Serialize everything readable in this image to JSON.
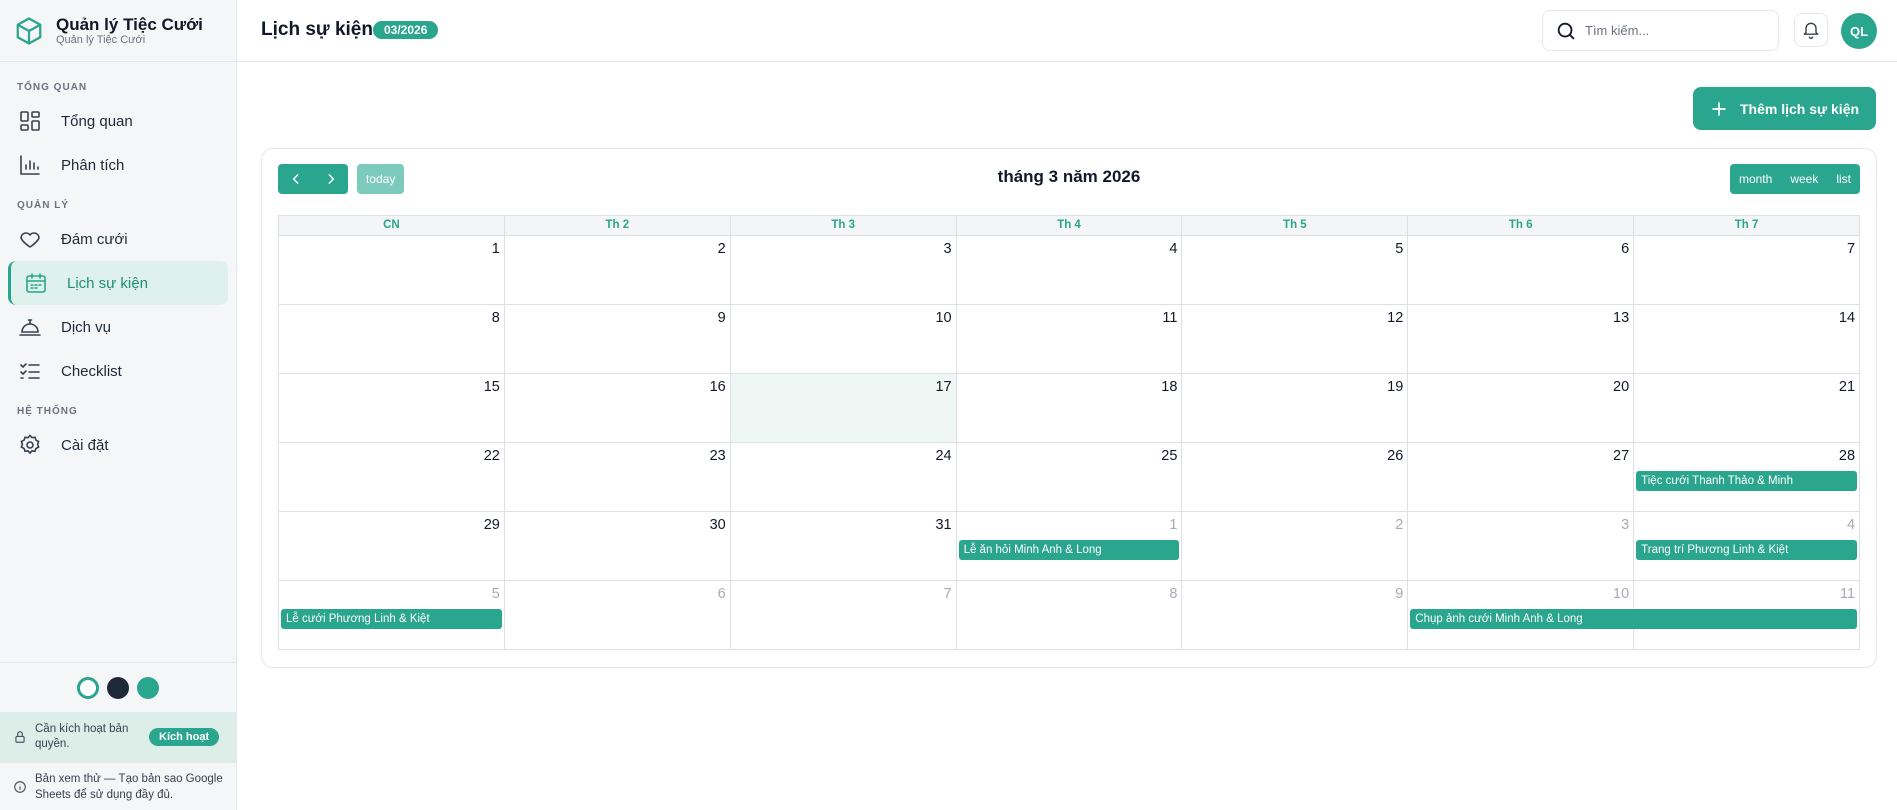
{
  "brand": {
    "title": "Quản lý Tiệc Cưới",
    "subtitle": "Quản lý Tiệc Cưới"
  },
  "sidebar": {
    "sections": [
      {
        "label": "TỔNG QUAN",
        "items": [
          {
            "label": "Tổng quan",
            "icon": "grid-icon"
          },
          {
            "label": "Phân tích",
            "icon": "chart-icon"
          }
        ]
      },
      {
        "label": "QUẢN LÝ",
        "items": [
          {
            "label": "Đám cưới",
            "icon": "heart-icon"
          },
          {
            "label": "Lịch sự kiện",
            "icon": "calendar-icon",
            "active": true
          },
          {
            "label": "Dịch vụ",
            "icon": "cloche-icon"
          },
          {
            "label": "Checklist",
            "icon": "checklist-icon"
          }
        ]
      },
      {
        "label": "HỆ THỐNG",
        "items": [
          {
            "label": "Cài đặt",
            "icon": "gear-icon"
          }
        ]
      }
    ],
    "license_text": "Cần kích hoạt bản quyền.",
    "license_button": "Kích hoạt",
    "trial_text": "Bản xem thử — Tạo bản sao Google Sheets để sử dụng đầy đủ."
  },
  "colors": {
    "accent": "#2aa58e",
    "accent_light": "#dff1ed",
    "today_bg": "#eef7f4",
    "dark_swatch": "#1f2937"
  },
  "header": {
    "title": "Lịch sự kiện",
    "badge": "03/2026",
    "search_placeholder": "Tìm kiếm...",
    "avatar_initials": "QL"
  },
  "main": {
    "add_button": "Thêm lịch sự kiện"
  },
  "calendar": {
    "title": "tháng 3 năm 2026",
    "today_label": "today",
    "views": [
      "month",
      "week",
      "list"
    ],
    "weekdays": [
      "CN",
      "Th 2",
      "Th 3",
      "Th 4",
      "Th 5",
      "Th 6",
      "Th 7"
    ],
    "weeks": [
      [
        {
          "d": "1"
        },
        {
          "d": "2"
        },
        {
          "d": "3"
        },
        {
          "d": "4"
        },
        {
          "d": "5"
        },
        {
          "d": "6"
        },
        {
          "d": "7"
        }
      ],
      [
        {
          "d": "8"
        },
        {
          "d": "9"
        },
        {
          "d": "10"
        },
        {
          "d": "11"
        },
        {
          "d": "12"
        },
        {
          "d": "13"
        },
        {
          "d": "14"
        }
      ],
      [
        {
          "d": "15"
        },
        {
          "d": "16"
        },
        {
          "d": "17",
          "today": true
        },
        {
          "d": "18"
        },
        {
          "d": "19"
        },
        {
          "d": "20"
        },
        {
          "d": "21"
        }
      ],
      [
        {
          "d": "22"
        },
        {
          "d": "23"
        },
        {
          "d": "24"
        },
        {
          "d": "25"
        },
        {
          "d": "26"
        },
        {
          "d": "27"
        },
        {
          "d": "28"
        }
      ],
      [
        {
          "d": "29"
        },
        {
          "d": "30"
        },
        {
          "d": "31"
        },
        {
          "d": "1",
          "other": true
        },
        {
          "d": "2",
          "other": true
        },
        {
          "d": "3",
          "other": true
        },
        {
          "d": "4",
          "other": true
        }
      ],
      [
        {
          "d": "5",
          "other": true
        },
        {
          "d": "6",
          "other": true
        },
        {
          "d": "7",
          "other": true
        },
        {
          "d": "8",
          "other": true
        },
        {
          "d": "9",
          "other": true
        },
        {
          "d": "10",
          "other": true
        },
        {
          "d": "11",
          "other": true
        }
      ]
    ],
    "events": [
      {
        "title": "Tiệc cưới Thanh Thảo & Minh",
        "week": 3,
        "start": 6,
        "span": 1
      },
      {
        "title": "Lễ ăn hỏi Minh Anh & Long",
        "week": 4,
        "start": 3,
        "span": 1
      },
      {
        "title": "Trang trí Phương Linh & Kiệt",
        "week": 4,
        "start": 6,
        "span": 1
      },
      {
        "title": "Lễ cưới Phương Linh & Kiệt",
        "week": 5,
        "start": 0,
        "span": 1
      },
      {
        "title": "Chụp ảnh cưới Minh Anh & Long",
        "week": 5,
        "start": 5,
        "span": 2
      }
    ]
  }
}
